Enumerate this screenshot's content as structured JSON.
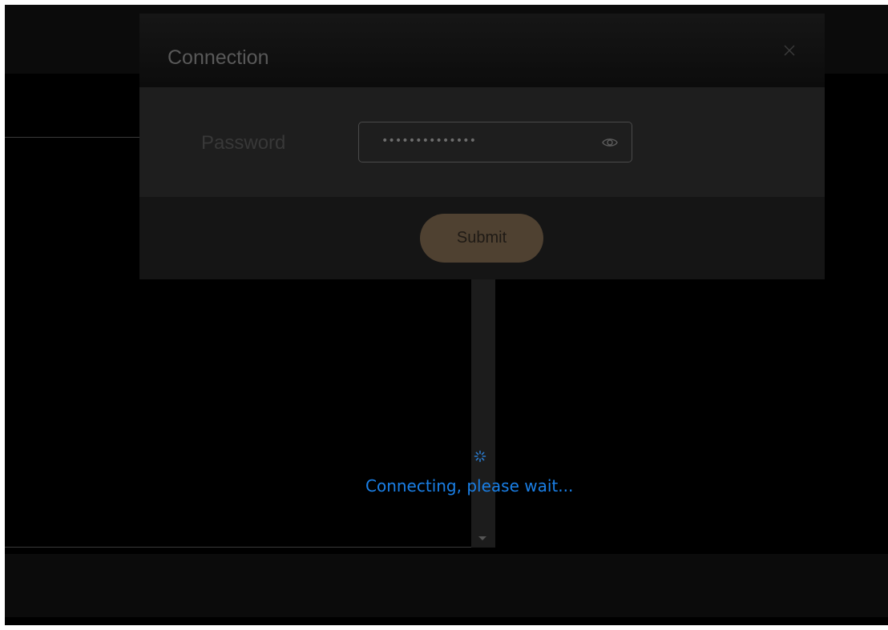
{
  "dialog": {
    "title": "Connection",
    "password_label": "Password",
    "password_value": "••••••••••••••",
    "submit_label": "Submit"
  },
  "status": {
    "message": "Connecting, please wait..."
  },
  "icons": {
    "close": "close-icon",
    "eye": "eye-icon",
    "spinner": "spinner-icon",
    "scroll_down": "chevron-down-icon"
  },
  "colors": {
    "status_text": "#1a7fe6",
    "submit_button": "#4f4131"
  }
}
